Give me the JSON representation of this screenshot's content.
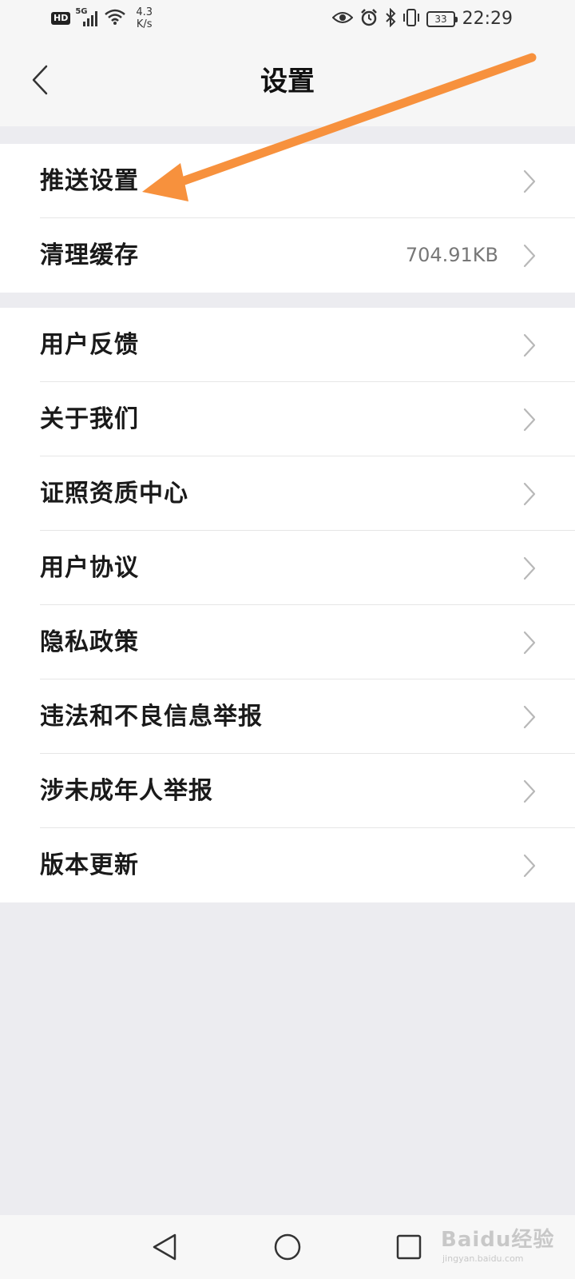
{
  "status_bar": {
    "hd": "HD",
    "net_type": "5G",
    "speed_value": "4.3",
    "speed_unit": "K/s",
    "battery": "33",
    "time": "22:29"
  },
  "header": {
    "title": "设置"
  },
  "groups": [
    {
      "items": [
        {
          "label": "推送设置",
          "value": ""
        },
        {
          "label": "清理缓存",
          "value": "704.91KB"
        }
      ]
    },
    {
      "items": [
        {
          "label": "用户反馈",
          "value": ""
        },
        {
          "label": "关于我们",
          "value": ""
        },
        {
          "label": "证照资质中心",
          "value": ""
        },
        {
          "label": "用户协议",
          "value": ""
        },
        {
          "label": "隐私政策",
          "value": ""
        },
        {
          "label": "违法和不良信息举报",
          "value": ""
        },
        {
          "label": "涉未成年人举报",
          "value": ""
        },
        {
          "label": "版本更新",
          "value": ""
        }
      ]
    }
  ],
  "watermark": {
    "brand": "Baidu经验",
    "url": "jingyan.baidu.com"
  },
  "colors": {
    "background": "#ececf0",
    "row": "#ffffff",
    "annotation_arrow": "#f7913d"
  }
}
